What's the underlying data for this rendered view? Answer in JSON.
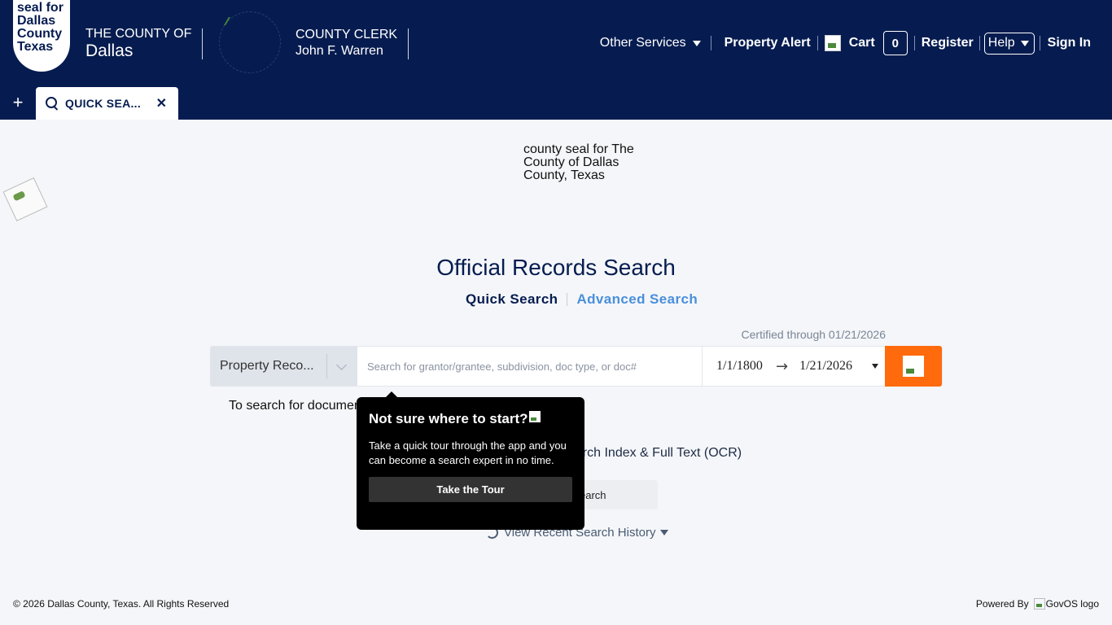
{
  "header": {
    "seal_alt": "seal for\nDallas\nCounty\nTexas",
    "county_prefix": "THE COUNTY OF",
    "county_name": "Dallas",
    "clerk_title": "COUNTY CLERK",
    "clerk_name": "John F. Warren"
  },
  "nav": {
    "other_services": "Other Services",
    "property_alert": "Property Alert",
    "cart_label": "Cart",
    "cart_count": "0",
    "register": "Register",
    "help": "Help",
    "sign_in": "Sign In"
  },
  "tabs": {
    "add": "+",
    "active_label": "QUICK SEA...",
    "close": "✕"
  },
  "main": {
    "seal_alt": "county seal for The County of Dallas County, Texas",
    "title": "Official Records Search",
    "quick_search": "Quick Search",
    "advanced_search": "Advanced Search",
    "certified": "Certified through 01/21/2026",
    "department": "Property Reco...",
    "search_placeholder": "Search for grantor/grantee, subdivision, doc type, or doc#",
    "date_from": "1/1/1800",
    "date_arrow": "→",
    "date_to": "1/21/2026",
    "hint_text": "To search for documer",
    "index_text": "earch Index & Full Text (OCR)",
    "partial_button": "earch",
    "recent_history": "View Recent Search History"
  },
  "tour": {
    "title": "Not sure where to start?",
    "body": "Take a quick tour through the app and you can become a search expert in no time.",
    "button": "Take the Tour"
  },
  "footer": {
    "copyright": "© 2026 Dallas County, Texas. All Rights Reserved",
    "powered_by": "Powered By",
    "govos_alt": "GovOS logo"
  },
  "colors": {
    "header_bg": "#061c50",
    "accent_orange": "#ff6a0c",
    "link_blue": "#4a8fdb"
  }
}
